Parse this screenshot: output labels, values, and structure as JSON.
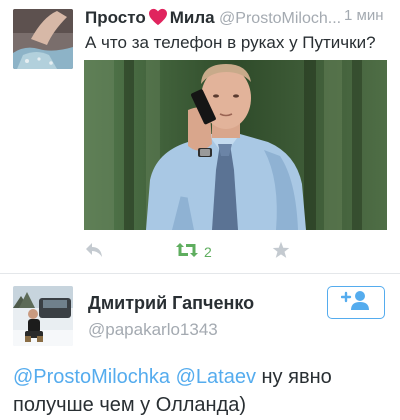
{
  "tweet": {
    "name_part1": "Просто",
    "name_part2": "Мила",
    "handle": "@ProstoMiloch...",
    "time": "1 мин",
    "text": "А что за телефон в руках у Путички?",
    "retweet_count": "2",
    "colors": {
      "heart": "#e0245e",
      "retweet": "#5fae5f",
      "muted_icon": "#c4cad0"
    },
    "icons": [
      "heart-icon",
      "reply-icon",
      "retweet-icon",
      "favorite-icon"
    ]
  },
  "user": {
    "name": "Дмитрий Гапченко",
    "handle": "@papakarlo1343",
    "icons": [
      "follow-user-icon"
    ],
    "colors": {
      "accent": "#55acee"
    }
  },
  "reply": {
    "mention1": "@ProstoMilochka",
    "mention2": "@Lataev",
    "text": " ну явно получше чем у Олланда)"
  }
}
